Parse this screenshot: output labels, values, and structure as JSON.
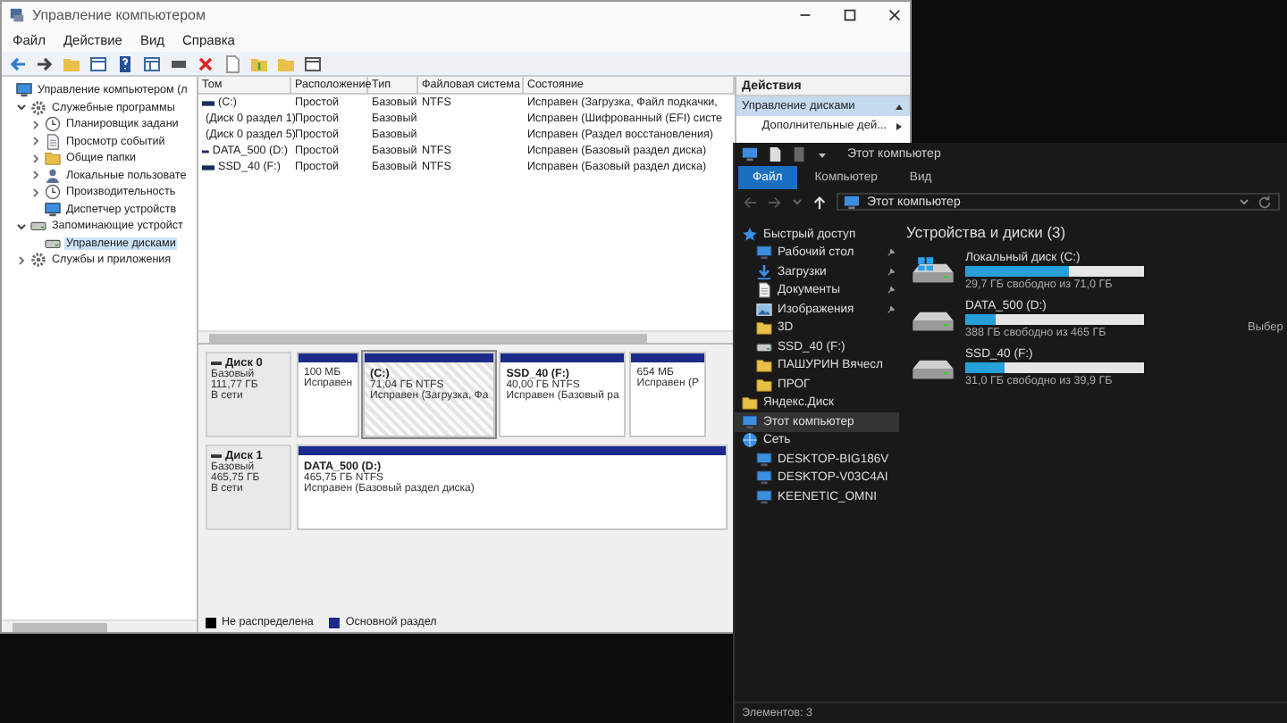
{
  "management_window": {
    "title": "Управление компьютером",
    "menu": [
      "Файл",
      "Действие",
      "Вид",
      "Справка"
    ],
    "tree": [
      {
        "label": "Управление компьютером (л",
        "kind": "monitor",
        "selected": false,
        "children": [
          {
            "label": "Служебные программы",
            "kind": "gear",
            "expanded": true,
            "selected": false,
            "children": [
              {
                "label": "Планировщик задани",
                "kind": "clock",
                "expanded": false,
                "selected": false
              },
              {
                "label": "Просмотр событий",
                "kind": "document",
                "expanded": false,
                "selected": false
              },
              {
                "label": "Общие папки",
                "kind": "folder",
                "expanded": false,
                "selected": false
              },
              {
                "label": "Локальные пользовате",
                "kind": "person",
                "expanded": false,
                "selected": false
              },
              {
                "label": "Производительность",
                "kind": "clock",
                "expanded": false,
                "selected": false
              },
              {
                "label": "Диспетчер устройств",
                "kind": "monitor",
                "selected": false
              }
            ]
          },
          {
            "label": "Запоминающие устройст",
            "kind": "drive",
            "expanded": true,
            "selected": false,
            "children": [
              {
                "label": "Управление дисками",
                "kind": "drive",
                "selected": true
              }
            ]
          },
          {
            "label": "Службы и приложения",
            "kind": "gear",
            "expanded": false,
            "selected": false
          }
        ]
      }
    ],
    "table": {
      "columns": [
        "Том",
        "Расположение",
        "Тип",
        "Файловая система",
        "Состояние"
      ],
      "rows": [
        {
          "volume": "(C:)",
          "layout": "Простой",
          "type": "Базовый",
          "fs": "NTFS",
          "status": "Исправен (Загрузка, Файл подкачки,"
        },
        {
          "volume": "(Диск 0 раздел 1)",
          "layout": "Простой",
          "type": "Базовый",
          "status": "Исправен (Шифрованный (EFI) систе"
        },
        {
          "volume": "(Диск 0 раздел 5)",
          "layout": "Простой",
          "type": "Базовый",
          "status": "Исправен (Раздел восстановления)"
        },
        {
          "volume": "DATA_500 (D:)",
          "layout": "Простой",
          "type": "Базовый",
          "fs": "NTFS",
          "status": "Исправен (Базовый раздел диска)"
        },
        {
          "volume": "SSD_40 (F:)",
          "layout": "Простой",
          "type": "Базовый",
          "fs": "NTFS",
          "status": "Исправен (Базовый раздел диска)"
        }
      ]
    },
    "disks": [
      {
        "name": "Диск 0",
        "type": "Базовый",
        "size": "111,77 ГБ",
        "state": "В сети",
        "partitions": [
          {
            "size": "100 МБ",
            "status": "Исправен",
            "selected": false
          },
          {
            "name": "(C:)",
            "size": "71,04 ГБ NTFS",
            "status": "Исправен (Загрузка, Фа",
            "selected": true
          },
          {
            "name": "SSD_40 (F:)",
            "size": "40,00 ГБ NTFS",
            "status": "Исправен (Базовый ра",
            "selected": false
          },
          {
            "size": "654 МБ",
            "status": "Исправен (Р",
            "selected": false
          }
        ]
      },
      {
        "name": "Диск 1",
        "type": "Базовый",
        "size": "465,75 ГБ",
        "state": "В сети",
        "partitions": [
          {
            "name": "DATA_500 (D:)",
            "size": "465,75 ГБ NTFS",
            "status": "Исправен (Базовый раздел диска)",
            "selected": false
          }
        ]
      }
    ],
    "legend": [
      {
        "label": "Не распределена",
        "color": "#000000"
      },
      {
        "label": "Основной раздел",
        "color": "#1c2a8c"
      }
    ],
    "actions": {
      "title": "Действия",
      "items": [
        {
          "label": "Управление дисками",
          "kind": "section"
        },
        {
          "label": "Дополнительные дей...",
          "kind": "submenu"
        }
      ]
    }
  },
  "explorer": {
    "title": "Этот компьютер",
    "ribbon_tabs": [
      {
        "label": "Файл",
        "selected": true
      },
      {
        "label": "Компьютер",
        "selected": false
      },
      {
        "label": "Вид",
        "selected": false
      }
    ],
    "address": "Этот компьютер",
    "nav": [
      {
        "label": "Быстрый доступ",
        "kind": "star",
        "selected": false,
        "children": [
          {
            "label": "Рабочий стол",
            "kind": "monitor",
            "pinned": true,
            "selected": false
          },
          {
            "label": "Загрузки",
            "kind": "download",
            "pinned": true,
            "selected": false
          },
          {
            "label": "Документы",
            "kind": "document",
            "pinned": true,
            "selected": false
          },
          {
            "label": "Изображения",
            "kind": "image",
            "pinned": true,
            "selected": false
          },
          {
            "label": "3D",
            "kind": "folder",
            "pinned": false,
            "selected": false
          },
          {
            "label": "SSD_40 (F:)",
            "kind": "drive",
            "pinned": false,
            "selected": false
          },
          {
            "label": "ПАШУРИН Вячесл",
            "kind": "folder",
            "pinned": false,
            "selected": false
          },
          {
            "label": "ПРОГ",
            "kind": "folder",
            "pinned": false,
            "selected": false
          }
        ]
      },
      {
        "label": "Яндекс.Диск",
        "kind": "folder",
        "selected": false
      },
      {
        "label": "Этот компьютер",
        "kind": "monitor",
        "selected": true
      },
      {
        "label": "Сеть",
        "kind": "network",
        "selected": false,
        "children": [
          {
            "label": "DESKTOP-BIG186V",
            "kind": "monitor",
            "pinned": false,
            "selected": false
          },
          {
            "label": "DESKTOP-V03C4AI",
            "kind": "monitor",
            "pinned": false,
            "selected": false
          },
          {
            "label": "KEENETIC_OMNI",
            "kind": "monitor",
            "pinned": false,
            "selected": false
          }
        ]
      }
    ],
    "section_title": "Устройства и диски (3)",
    "drives": [
      {
        "name": "Локальный диск (C:)",
        "free": "29,7 ГБ свободно из 71,0 ГБ",
        "level": 0.58,
        "system": true
      },
      {
        "name": "DATA_500 (D:)",
        "free": "388 ГБ свободно из 465 ГБ",
        "level": 0.17,
        "system": false
      },
      {
        "name": "SSD_40 (F:)",
        "free": "31,0 ГБ свободно из 39,9 ГБ",
        "level": 0.22,
        "system": false
      }
    ],
    "preview_hint": "Выбер",
    "status": "Элементов: 3"
  }
}
